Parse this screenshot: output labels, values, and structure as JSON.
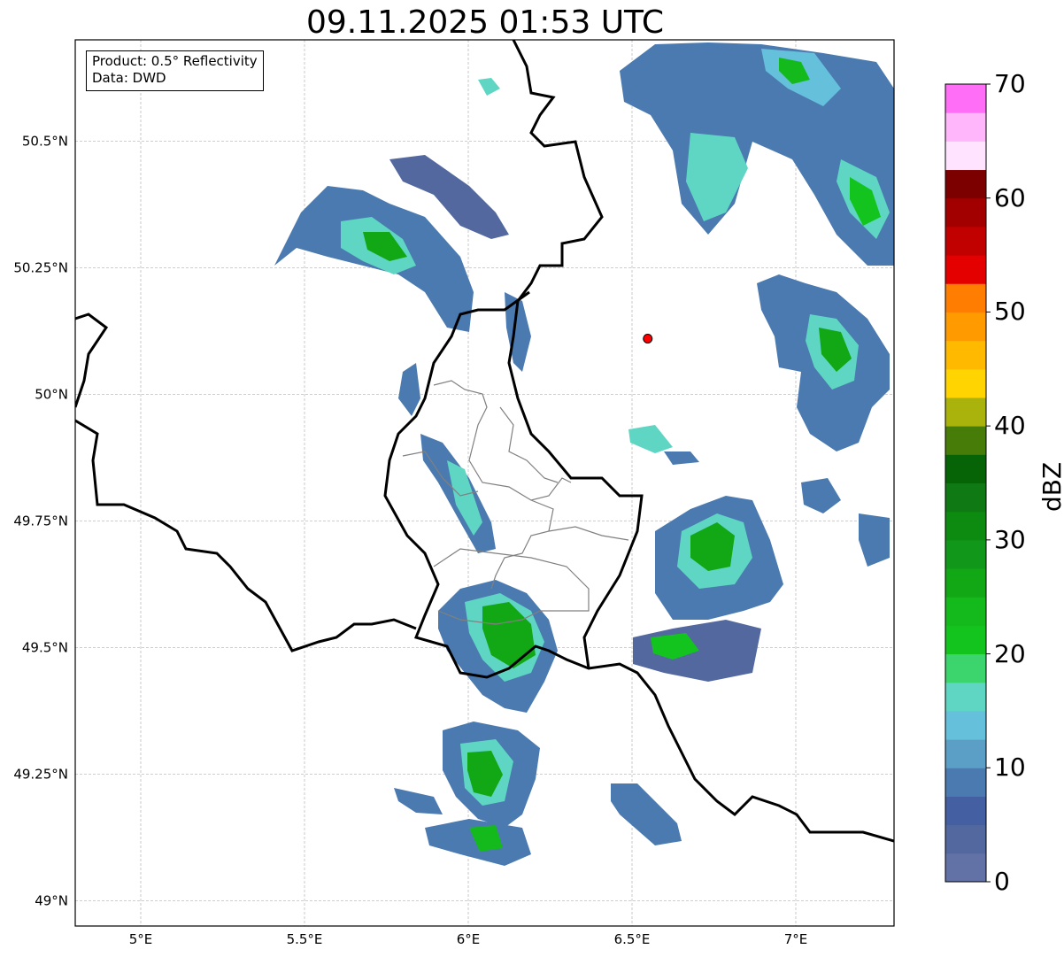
{
  "title": "09.11.2025 01:53 UTC",
  "infobox": {
    "line1": "Product: 0.5° Reflectivity",
    "line2": "Data: DWD"
  },
  "map": {
    "lon_range": [
      4.8,
      7.3
    ],
    "lat_range": [
      48.95,
      50.7
    ],
    "lat_ticks": [
      {
        "value": 49.0,
        "label": "49°N"
      },
      {
        "value": 49.25,
        "label": "49.25°N"
      },
      {
        "value": 49.5,
        "label": "49.5°N"
      },
      {
        "value": 49.75,
        "label": "49.75°N"
      },
      {
        "value": 50.0,
        "label": "50°N"
      },
      {
        "value": 50.25,
        "label": "50.25°N"
      },
      {
        "value": 50.5,
        "label": "50.5°N"
      }
    ],
    "lon_ticks": [
      {
        "value": 5.0,
        "label": "5°E"
      },
      {
        "value": 5.5,
        "label": "5.5°E"
      },
      {
        "value": 6.0,
        "label": "6°E"
      },
      {
        "value": 6.5,
        "label": "6.5°E"
      },
      {
        "value": 7.0,
        "label": "7°E"
      }
    ],
    "gridlines": true,
    "radar_site": {
      "lon": 6.548,
      "lat": 50.11,
      "color": "#ff0000"
    }
  },
  "colorbar": {
    "unit": "dBZ",
    "range": [
      0,
      70
    ],
    "step": 2.5,
    "tick_labels": [
      "0",
      "10",
      "20",
      "30",
      "40",
      "50",
      "60",
      "70"
    ],
    "colors": [
      "#6272a7",
      "#53689f",
      "#4460a2",
      "#4a7ab0",
      "#5b9fc7",
      "#65c0db",
      "#5fd6c4",
      "#3cd56d",
      "#12c41d",
      "#14ba1b",
      "#12a715",
      "#11981a",
      "#0d8a10",
      "#0f7a14",
      "#066406",
      "#477c09",
      "#aab20c",
      "#ffd400",
      "#ffba00",
      "#ff9b00",
      "#ff7d00",
      "#e50000",
      "#c10000",
      "#a20000",
      "#7c0000",
      "#ffe3ff",
      "#ffb6fa",
      "#ff6ef6",
      "#ec3aef"
    ]
  }
}
